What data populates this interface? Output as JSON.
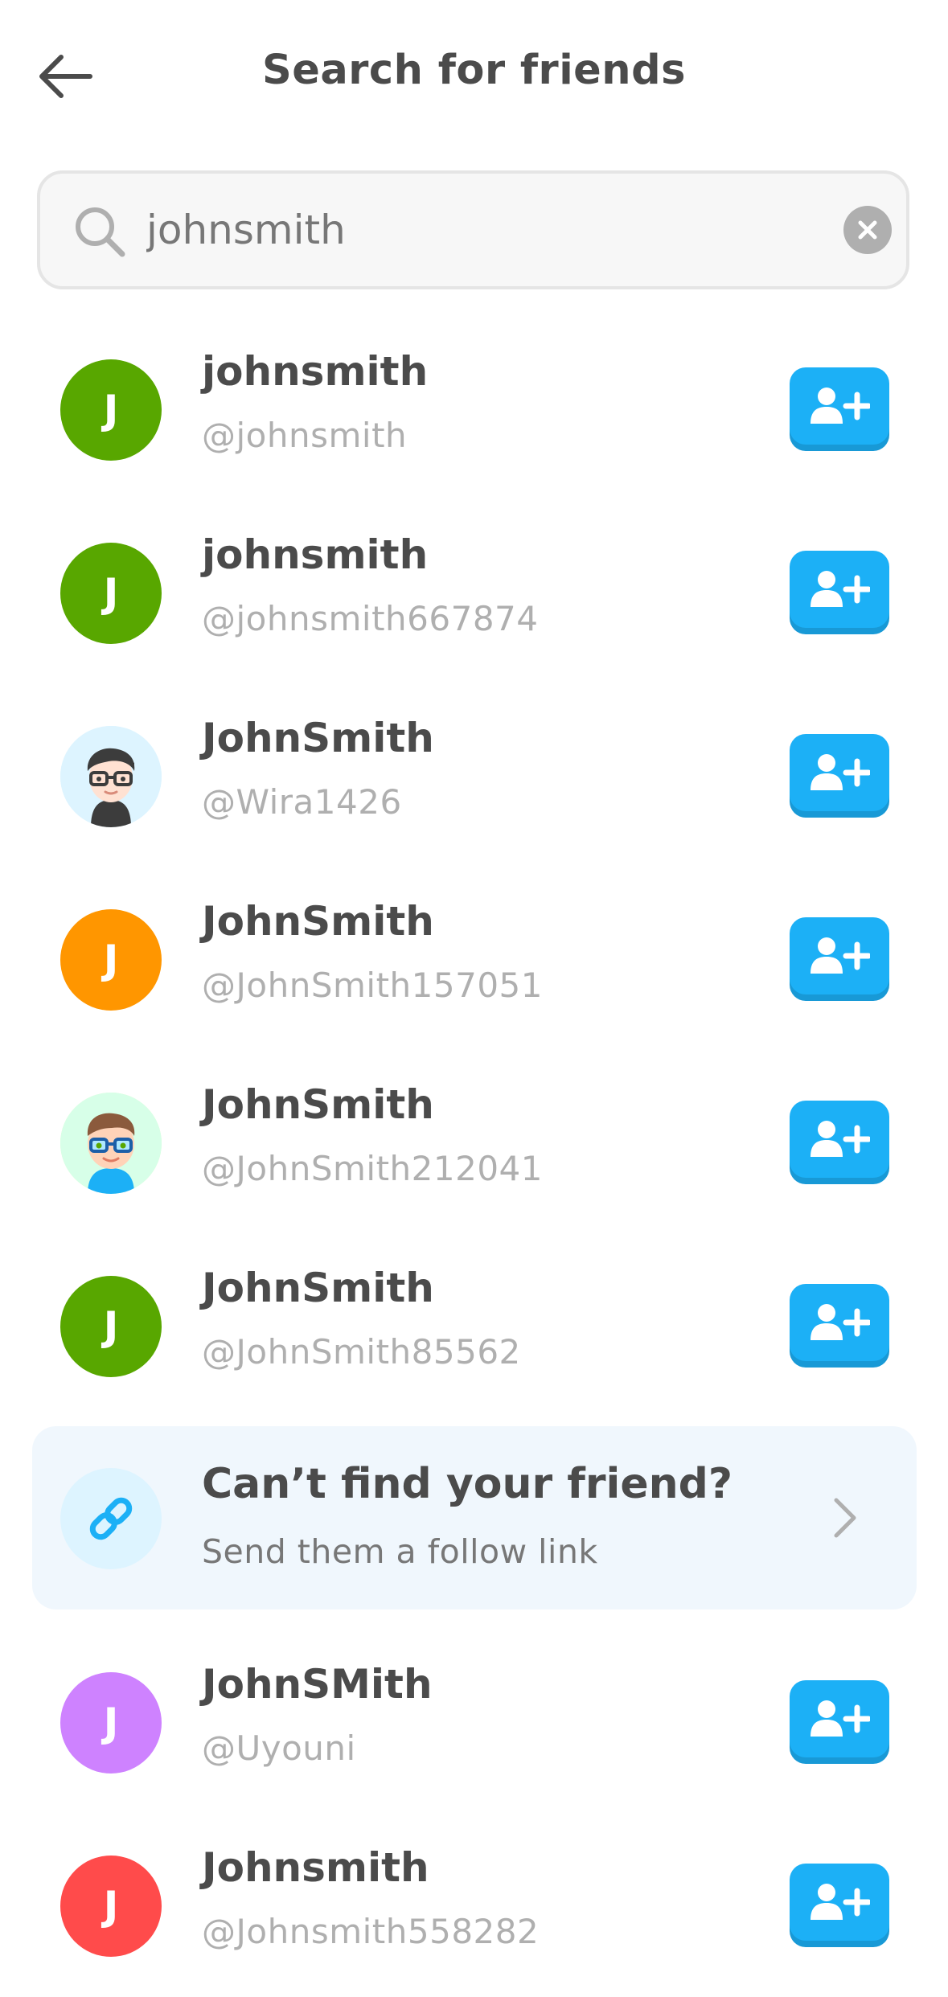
{
  "header": {
    "title": "Search for friends"
  },
  "search": {
    "value": "johnsmith",
    "placeholder": "Search for friends"
  },
  "results": [
    {
      "name": "johnsmith",
      "handle": "@johnsmith",
      "initial": "J",
      "avatar_color": "#58a700",
      "avatar_type": "initial"
    },
    {
      "name": "johnsmith",
      "handle": "@johnsmith667874",
      "initial": "J",
      "avatar_color": "#58a700",
      "avatar_type": "initial"
    },
    {
      "name": "JohnSmith",
      "handle": "@Wira1426",
      "initial": "",
      "avatar_color": "#ddf4ff",
      "avatar_type": "character-glasses-dark"
    },
    {
      "name": "JohnSmith",
      "handle": "@JohnSmith157051",
      "initial": "J",
      "avatar_color": "#ff9600",
      "avatar_type": "initial"
    },
    {
      "name": "JohnSmith",
      "handle": "@JohnSmith212041",
      "initial": "",
      "avatar_color": "#d7ffb8",
      "avatar_type": "character-glasses-brown"
    },
    {
      "name": "JohnSmith",
      "handle": "@JohnSmith85562",
      "initial": "J",
      "avatar_color": "#58a700",
      "avatar_type": "initial"
    }
  ],
  "link_card": {
    "title": "Can’t find your friend?",
    "subtitle": "Send them a follow link"
  },
  "results_after": [
    {
      "name": "JohnSMith",
      "handle": "@Uyouni",
      "initial": "J",
      "avatar_color": "#ce82ff",
      "avatar_type": "initial"
    },
    {
      "name": "Johnsmith",
      "handle": "@Johnsmith558282",
      "initial": "J",
      "avatar_color": "#ff4b4b",
      "avatar_type": "initial"
    }
  ],
  "colors": {
    "accent": "#1cb0f6",
    "accent_shadow": "#1899d6",
    "text": "#4b4b4b",
    "muted": "#afafaf"
  },
  "icons": {
    "back": "arrow-left-icon",
    "search": "magnifier-icon",
    "clear": "close-circle-icon",
    "follow": "add-user-icon",
    "link": "link-icon",
    "chevron": "chevron-right-icon"
  }
}
